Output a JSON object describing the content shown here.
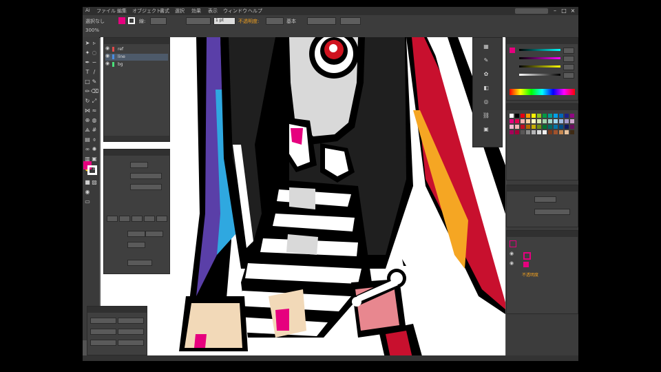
{
  "menubar": {
    "items": [
      "ファイル",
      "編集",
      "オブジェクト",
      "書式",
      "選択",
      "効果",
      "表示",
      "ウィンドウ",
      "ヘルプ"
    ],
    "window_controls": [
      "–",
      "□",
      "×"
    ]
  },
  "controlbar": {
    "selection_label": "選択なし",
    "stroke_weight": "1 pt",
    "zoom": "300%",
    "style_label": "基本"
  },
  "layers_panel": {
    "layers": [
      {
        "name": "ref",
        "color": "#e04a4a"
      },
      {
        "name": "line",
        "color": "#4a8de0"
      },
      {
        "name": "bg",
        "color": "#4ae07a"
      }
    ]
  },
  "colors": {
    "fill": "#e6007e",
    "stroke": "#ffffff",
    "hair": "#1f1f1f",
    "purple": "#5a3fa8",
    "cyan": "#2fa8e0",
    "red": "#c8102e",
    "orange": "#f5a623",
    "skin": "#f2d9b8",
    "eye_red": "#d0131f",
    "face": "#d9d9d9"
  },
  "swatches": [
    "#ffffff",
    "#000000",
    "#e60012",
    "#f39800",
    "#fff100",
    "#8fc31f",
    "#009944",
    "#009e96",
    "#00a0e9",
    "#0068b7",
    "#1d2088",
    "#920783",
    "#e4007f",
    "#e5004f",
    "#f5b2b2",
    "#fad3a5",
    "#fffac2",
    "#d7e7af",
    "#a5d4ad",
    "#a3d6cc",
    "#a0d8ef",
    "#a3bce2",
    "#a59aca",
    "#cfa7cd",
    "#f4b4d0",
    "#f5b2b5",
    "#c30d23",
    "#b46800",
    "#c8ae00",
    "#6f8e16",
    "#007130",
    "#006a65",
    "#0075a9",
    "#004c84",
    "#0f1960",
    "#6c0d5f",
    "#a4005b",
    "#a40038",
    "#595757",
    "#898989",
    "#b5b5b6",
    "#dcdddd",
    "#efefef",
    "#7d3a1b",
    "#a0522d",
    "#c88a52",
    "#e8c39e",
    "#3e2a14"
  ]
}
